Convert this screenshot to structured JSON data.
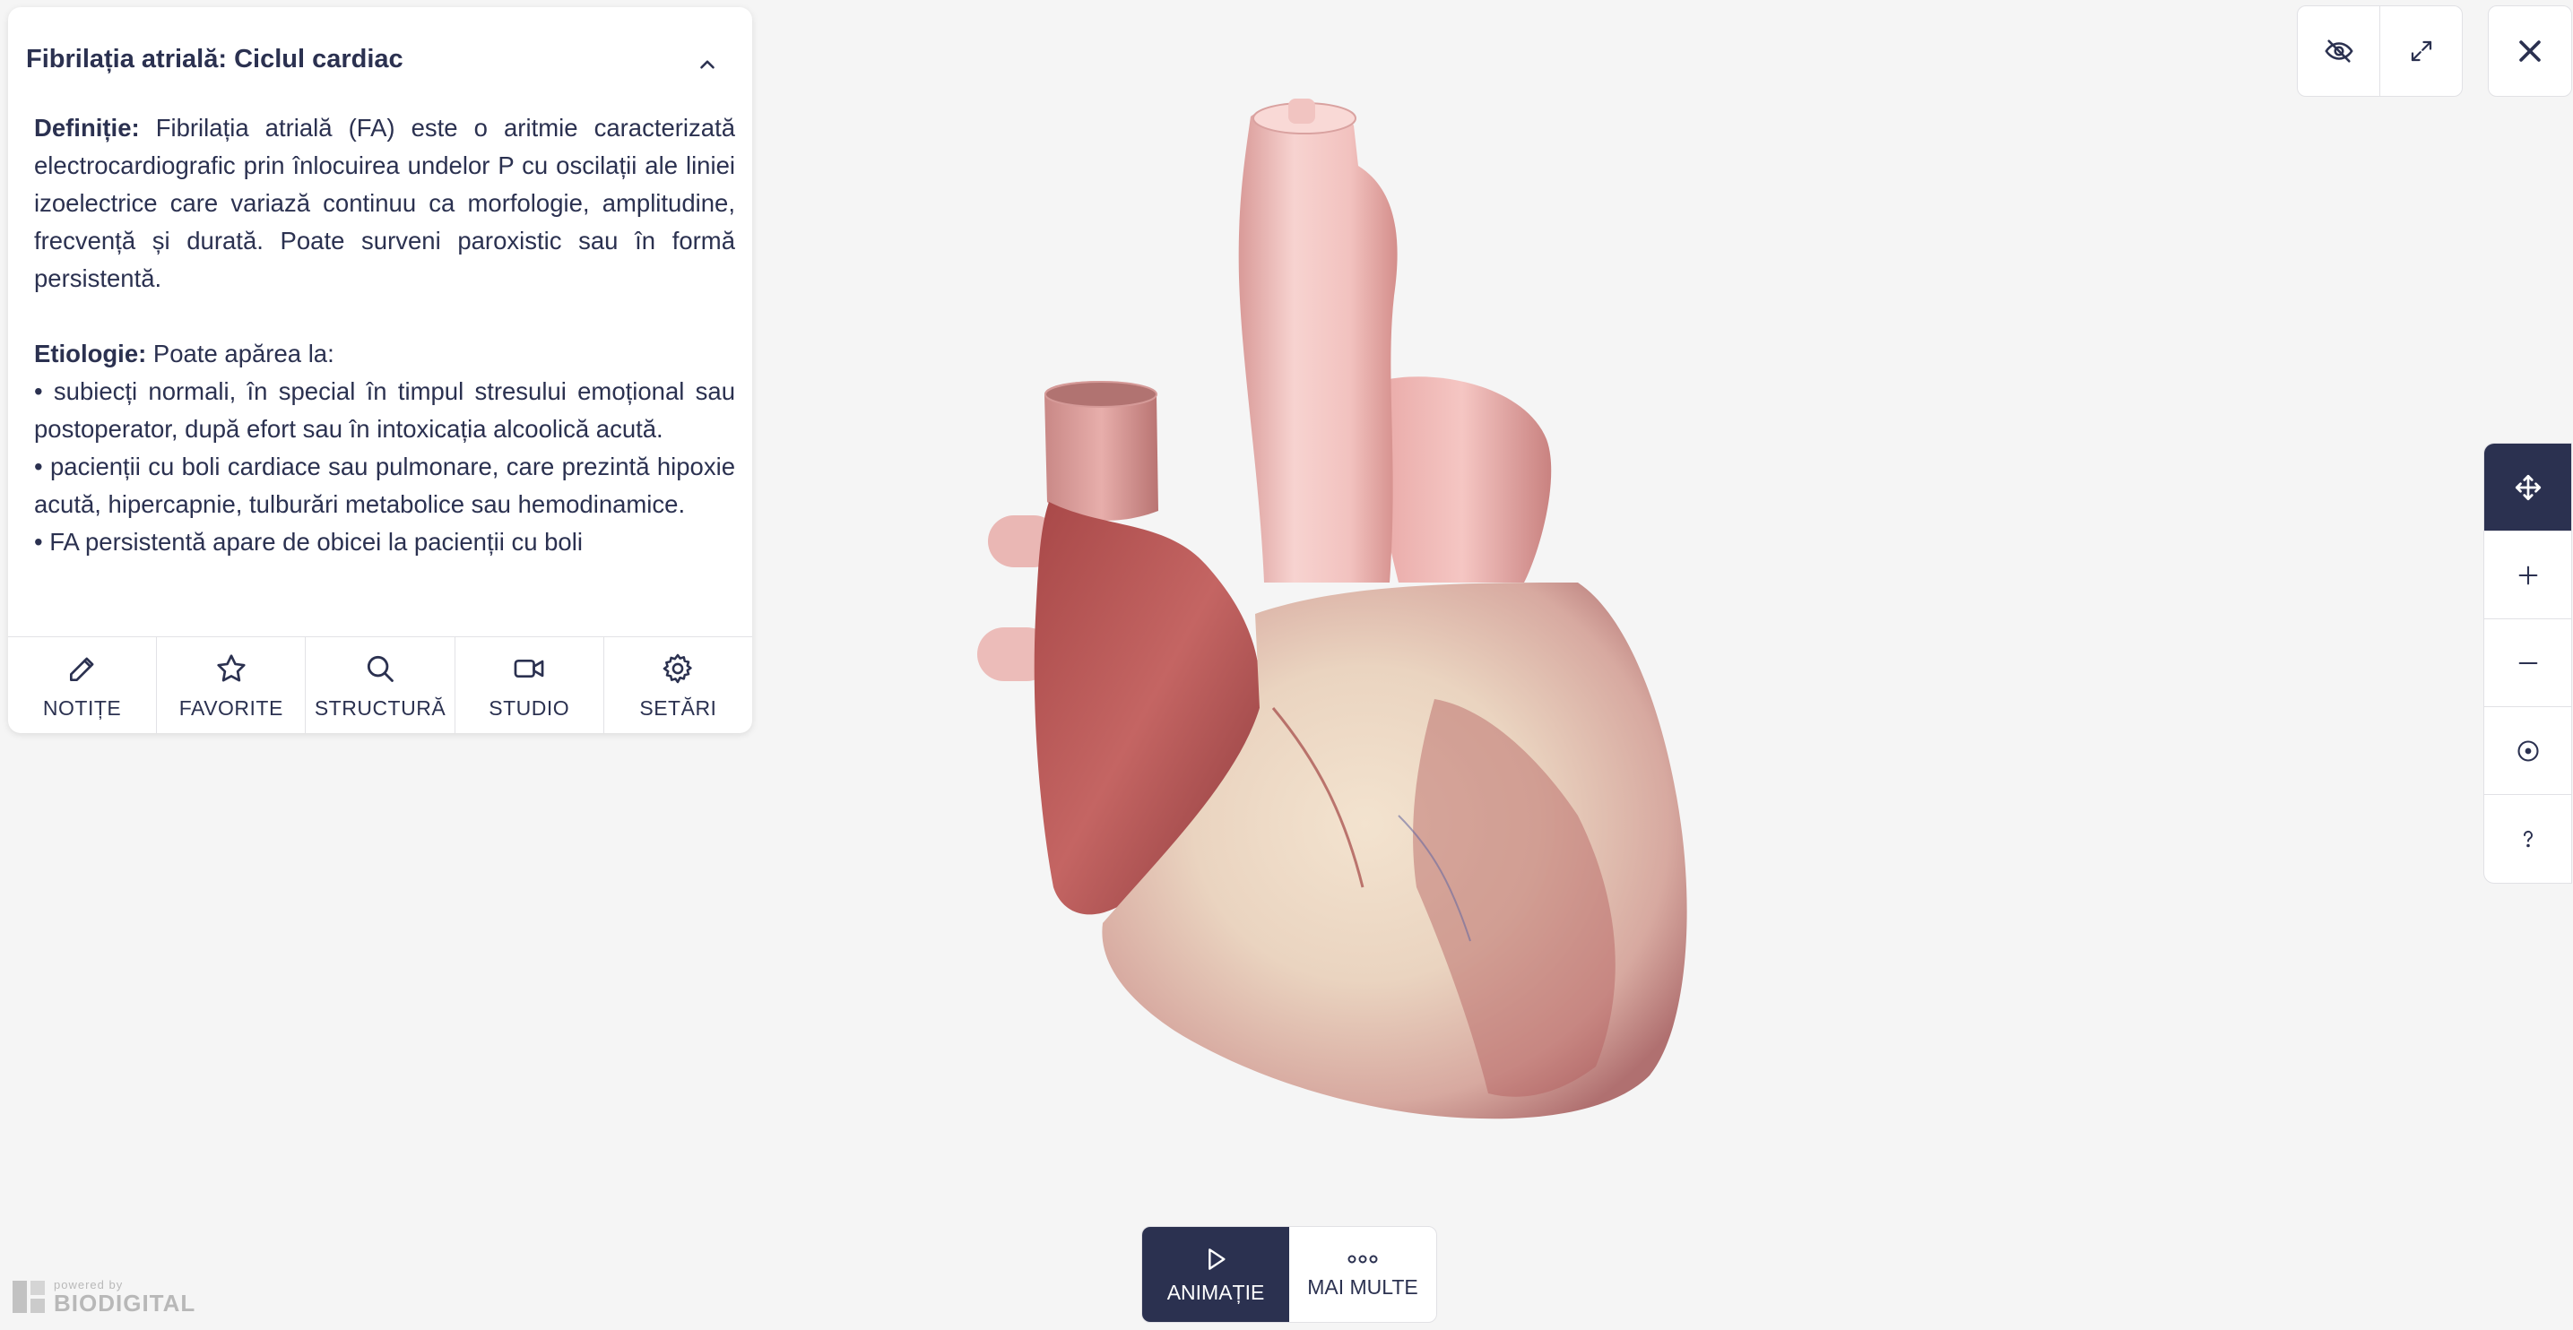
{
  "panel": {
    "title": "Fibrilația atrială: Ciclul cardiac",
    "definition_label": "Definiție:",
    "definition_text": " Fibrilația atrială (FA) este o aritmie caracterizată electrocardiografic prin înlocuirea undelor P cu oscilații ale liniei izoelectrice care variază continuu ca morfologie, amplitudine, frecvență și durată. Poate surveni paroxistic sau în formă persistentă.",
    "etiology_label": "Etiologie:",
    "etiology_text": " Poate apărea la:",
    "bullets": [
      "• subiecți normali, în special în timpul stresului emoțional sau postoperator, după efort sau în intoxicația alcoolică acută.",
      "• pacienții cu boli cardiace sau pulmonare, care prezintă hipoxie acută, hipercapnie, tulburări metabolice sau hemodinamice.",
      "• FA persistentă apare de obicei la pacienții cu boli"
    ]
  },
  "toolbar": {
    "items": [
      {
        "label": "NOTIȚE",
        "icon": "pencil-icon"
      },
      {
        "label": "FAVORITE",
        "icon": "star-icon"
      },
      {
        "label": "STRUCTURĂ",
        "icon": "search-icon"
      },
      {
        "label": "STUDIO",
        "icon": "video-camera-icon"
      },
      {
        "label": "SETĂRI",
        "icon": "gear-icon"
      }
    ]
  },
  "top_right": {
    "icons": [
      "eye-slash-icon",
      "expand-icon",
      "close-icon"
    ]
  },
  "nav_rail": {
    "icons": [
      "move-arrows-icon",
      "plus-icon",
      "minus-icon",
      "center-icon",
      "help-icon"
    ],
    "active": "move-arrows-icon"
  },
  "bottom": {
    "animation_label": "ANIMAȚIE",
    "more_label": "MAI MULTE"
  },
  "branding": {
    "powered_by": "powered by",
    "name": "BIODIGITAL"
  },
  "colors": {
    "primary": "#2b3150",
    "background": "#f5f5f5",
    "panel": "#ffffff"
  }
}
